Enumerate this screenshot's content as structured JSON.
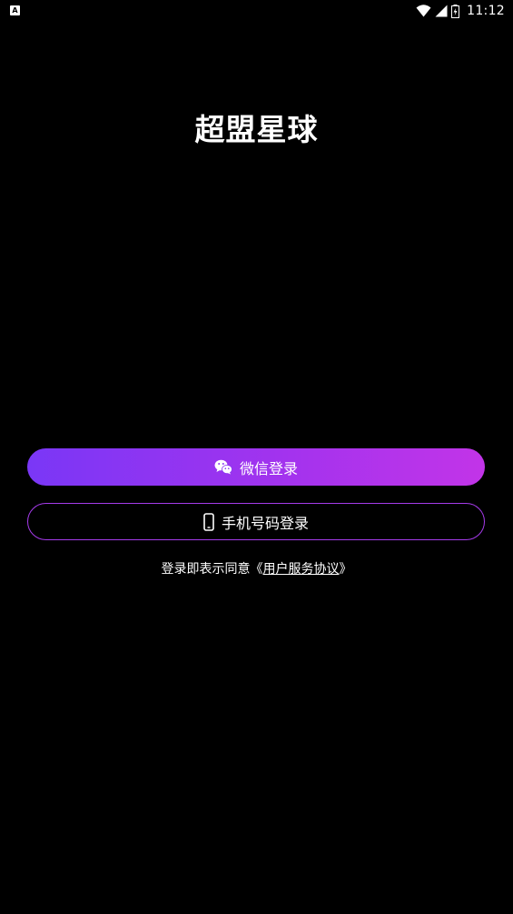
{
  "status_bar": {
    "notification_icon": "a-icon",
    "time": "11:12",
    "icons": [
      "wifi-icon",
      "signal-icon",
      "battery-icon"
    ]
  },
  "app": {
    "title": "超盟星球"
  },
  "login": {
    "wechat_label": "微信登录",
    "wechat_icon": "wechat-icon",
    "phone_label": "手机号码登录",
    "phone_icon": "phone-icon",
    "gradient_start": "#7a37f6",
    "gradient_end": "#c234e8",
    "outline_color": "#a53bea"
  },
  "agreement": {
    "prefix": "登录即表示同意",
    "open_bracket": "《",
    "link_text": "用户服务协议",
    "close_bracket": "》"
  }
}
